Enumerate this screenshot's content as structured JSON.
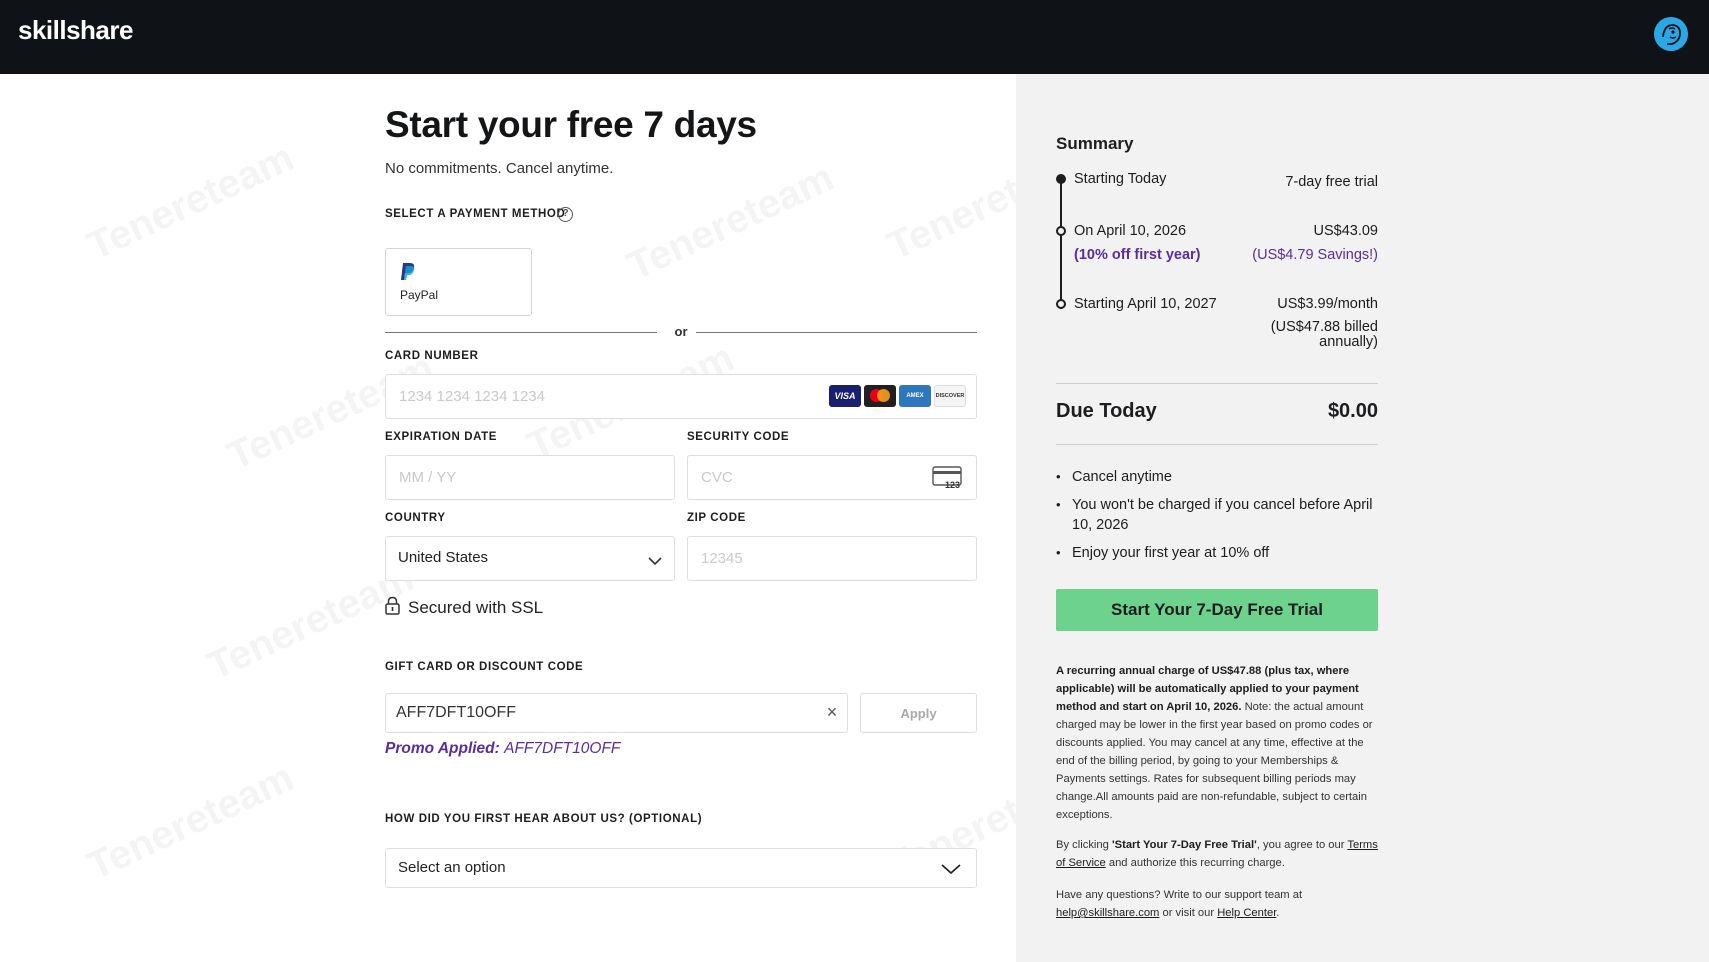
{
  "header": {
    "logo": "skillshare"
  },
  "form": {
    "title": "Start your free 7 days",
    "subtitle": "No commitments. Cancel anytime.",
    "payment_method_label": "SELECT A PAYMENT METHOD",
    "help_glyph": "?",
    "paypal_label": "PayPal",
    "divider_text": "or",
    "card_number_label": "CARD NUMBER",
    "card_number_placeholder": "1234 1234 1234 1234",
    "card_logos": [
      "VISA",
      "",
      "AMEX",
      "DISCOVER"
    ],
    "expiration_label": "EXPIRATION DATE",
    "expiration_placeholder": "MM / YY",
    "security_label": "SECURITY CODE",
    "security_placeholder": "CVC",
    "cvc_icon_text": "123",
    "country_label": "COUNTRY",
    "country_value": "United States",
    "zip_label": "ZIP CODE",
    "zip_placeholder": "12345",
    "ssl_text": "Secured with SSL",
    "gift_label": "GIFT CARD OR DISCOUNT CODE",
    "gift_value": "AFF7DFT10OFF",
    "clear_glyph": "×",
    "apply_label": "Apply",
    "promo_prefix": "Promo Applied:",
    "promo_code": "AFF7DFT10OFF",
    "hear_label": "HOW DID YOU FIRST HEAR ABOUT US? (OPTIONAL)",
    "hear_value": "Select an option"
  },
  "summary": {
    "title": "Summary",
    "timeline": [
      {
        "left": "Starting Today",
        "right": "7-day free trial"
      },
      {
        "left": "On April 10, 2026",
        "right": "US$43.09",
        "left_sub": "(10% off first year)",
        "right_sub": "(US$4.79 Savings!)"
      },
      {
        "left": "Starting April 10, 2027",
        "right": "US$3.99/month",
        "right_sub_1": "(US$47.88 billed",
        "right_sub_2": "annually)"
      }
    ],
    "due_label": "Due Today",
    "due_value": "$0.00",
    "bullets": [
      "Cancel anytime",
      "You won't be charged if you cancel before April 10, 2026",
      "Enjoy your first year at 10% off"
    ],
    "cta_label": "Start Your 7-Day Free Trial",
    "fine_bold": "A recurring annual charge of US$47.88 (plus tax, where applicable) will be automatically applied to your payment method and start on April 10, 2026.",
    "fine_rest": " Note: the actual amount charged may be lower in the first year based on promo codes or discounts applied. You may cancel at any time, effective at the end of the billing period, by going to your Memberships & Payments settings. Rates for subsequent billing periods may change.All amounts paid are non-refundable, subject to certain exceptions.",
    "agree_prefix": "By clicking ",
    "agree_bold": "'Start Your 7-Day Free Trial'",
    "agree_mid": ", you agree to our ",
    "terms_link": "Terms of Service",
    "agree_suffix": " and authorize this recurring charge.",
    "support_prefix": "Have any questions? Write to our support team at ",
    "support_email": "help@skillshare.com",
    "support_mid": " or visit our ",
    "help_center": "Help Center",
    "support_suffix": "."
  },
  "colors": {
    "header_bg": "#0f1216",
    "accent_green": "#6dd28e",
    "promo_purple": "#5a2d9c",
    "summary_bg": "#f2f2f2"
  },
  "icons": [
    "avatar-icon",
    "help-icon",
    "paypal-icon",
    "lock-icon",
    "cvc-card-icon",
    "chevron-down-icon",
    "clear-icon"
  ]
}
